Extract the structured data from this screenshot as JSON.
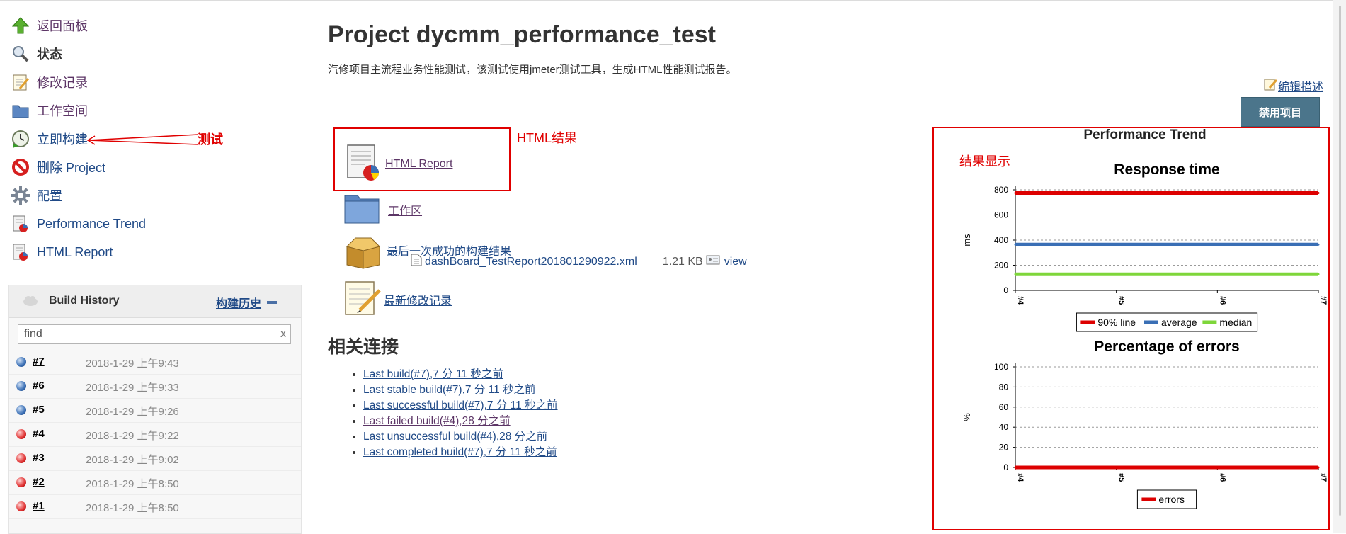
{
  "sidebar": {
    "tasks": [
      {
        "label": "返回面板",
        "icon": "up-arrow-icon"
      },
      {
        "label": "状态",
        "icon": "magnifier-icon"
      },
      {
        "label": "修改记录",
        "icon": "notepad-icon"
      },
      {
        "label": "工作空间",
        "icon": "folder-icon"
      },
      {
        "label": "立即构建",
        "icon": "clock-build-icon"
      },
      {
        "label": "删除 Project",
        "icon": "no-entry-icon"
      },
      {
        "label": "配置",
        "icon": "gear-icon"
      },
      {
        "label": "Performance Trend",
        "icon": "report-chart-icon"
      },
      {
        "label": "HTML Report",
        "icon": "report-chart-icon"
      }
    ],
    "annotation_test": "测试"
  },
  "build_history": {
    "title": "Build History",
    "link_label": "构建历史",
    "search_value": "find",
    "clear_glyph": "x",
    "builds": [
      {
        "number": "#7",
        "date": "2018-1-29 上午9:43",
        "status": "blue"
      },
      {
        "number": "#6",
        "date": "2018-1-29 上午9:33",
        "status": "blue"
      },
      {
        "number": "#5",
        "date": "2018-1-29 上午9:26",
        "status": "blue"
      },
      {
        "number": "#4",
        "date": "2018-1-29 上午9:22",
        "status": "red"
      },
      {
        "number": "#3",
        "date": "2018-1-29 上午9:02",
        "status": "red"
      },
      {
        "number": "#2",
        "date": "2018-1-29 上午8:50",
        "status": "red"
      },
      {
        "number": "#1",
        "date": "2018-1-29 上午8:50",
        "status": "red"
      }
    ]
  },
  "main": {
    "title": "Project dycmm_performance_test",
    "description": "汽修项目主流程业务性能测试，该测试使用jmeter测试工具，生成HTML性能测试报告。",
    "edit_description": "编辑描述",
    "disable_button": "禁用项目",
    "html_report_link": "HTML Report",
    "annotation_html_result": "HTML结果",
    "workspace_link": "工作区",
    "last_success_link": "最后一次成功的构建结果",
    "artifact": {
      "name": "dashBoard_TestReport201801290922.xml",
      "size": "1.21 KB",
      "view": "view"
    },
    "changes_link": "最新修改记录",
    "related_title": "相关连接",
    "related_links": [
      "Last build(#7),7 分 11 秒之前",
      "Last stable build(#7),7 分 11 秒之前",
      "Last successful build(#7),7 分 11 秒之前",
      "Last failed build(#4),28 分之前",
      "Last unsuccessful build(#4),28 分之前",
      "Last completed build(#7),7 分 11 秒之前"
    ]
  },
  "performance": {
    "title": "Performance Trend",
    "annotation_result": "结果显示"
  },
  "colors": {
    "link": "#204a87",
    "annotation": "#e00000",
    "button": "#4b758b"
  },
  "chart_data": [
    {
      "type": "line",
      "title": "Response time",
      "xlabel": "",
      "ylabel": "ms",
      "x": [
        "#4",
        "#5",
        "#6",
        "#7"
      ],
      "ylim": [
        0,
        800
      ],
      "yticks": [
        "0",
        "200",
        "400",
        "600",
        "800"
      ],
      "grid": true,
      "legend": "bottom",
      "series": [
        {
          "name": "90% line",
          "color": "#dd0000",
          "values": [
            775,
            775,
            775,
            775
          ]
        },
        {
          "name": "average",
          "color": "#3a6fb5",
          "values": [
            365,
            365,
            365,
            365
          ]
        },
        {
          "name": "median",
          "color": "#7ed63a",
          "values": [
            128,
            128,
            128,
            128
          ]
        }
      ]
    },
    {
      "type": "line",
      "title": "Percentage of errors",
      "xlabel": "",
      "ylabel": "%",
      "x": [
        "#4",
        "#5",
        "#6",
        "#7"
      ],
      "ylim": [
        0,
        100
      ],
      "yticks": [
        "0",
        "20",
        "40",
        "60",
        "80",
        "100"
      ],
      "grid": true,
      "legend": "bottom",
      "series": [
        {
          "name": "errors",
          "color": "#dd0000",
          "values": [
            0,
            0,
            0,
            0
          ]
        }
      ]
    }
  ]
}
